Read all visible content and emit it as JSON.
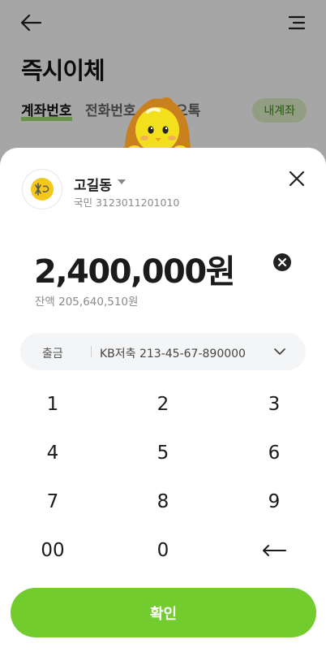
{
  "header": {
    "title": "즉시이체",
    "back_icon": "arrow-left-icon",
    "menu_icon": "menu-icon"
  },
  "tabs": [
    {
      "label": "계좌번호",
      "active": true
    },
    {
      "label": "전화번호",
      "active": false
    },
    {
      "label": "오톡",
      "active": false
    }
  ],
  "my_account_label": "내계좌",
  "recipient": {
    "name": "고길동",
    "account": "국민 3123011201010"
  },
  "transfer": {
    "amount": "2,400,000원",
    "balance": "잔액 205,640,510원"
  },
  "withdraw": {
    "label": "출금",
    "account": "KB저축 213-45-67-890000"
  },
  "keypad": {
    "keys": [
      "1",
      "2",
      "3",
      "4",
      "5",
      "6",
      "7",
      "8",
      "9",
      "00",
      "0"
    ],
    "backspace_icon": "backspace-arrow-icon"
  },
  "confirm_label": "확인",
  "colors": {
    "accent": "#72cc2e",
    "tab_underline": "#7dd13a",
    "pill_bg": "#dff3c9",
    "pill_text": "#3d8a1a"
  }
}
